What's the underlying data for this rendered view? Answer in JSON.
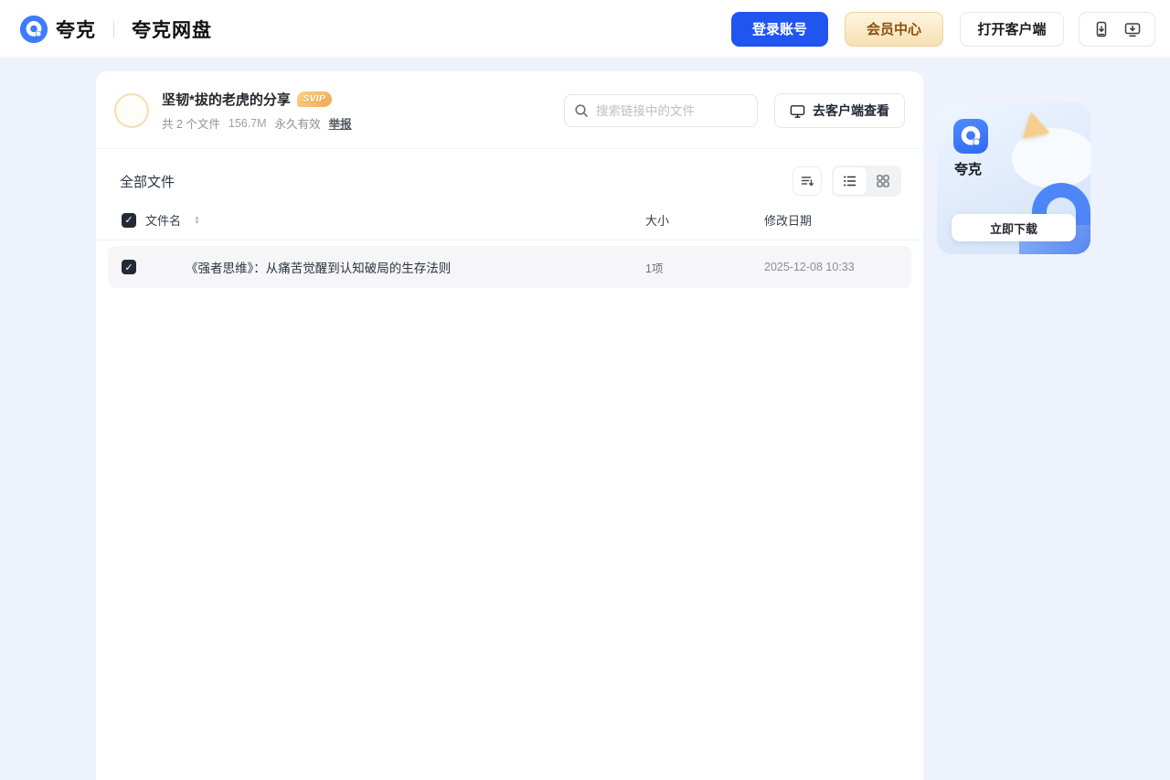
{
  "header": {
    "logo_text": "夸克",
    "logo_product": "夸克网盘",
    "login_button": "登录账号",
    "vip_button": "会员中心",
    "open_client_button": "打开客户端",
    "icons": [
      "mobile-download-icon",
      "desktop-download-icon"
    ]
  },
  "share": {
    "title": "坚韧*拔的老虎的分享",
    "badge": "SVIP",
    "meta_files": "共 2 个文件",
    "meta_size": "156.7M",
    "meta_valid": "永久有效",
    "report_link": "举报",
    "search_placeholder": "搜索链接中的文件",
    "client_view_button": "去客户端查看"
  },
  "files": {
    "section_title": "全部文件",
    "columns": {
      "name": "文件名",
      "size": "大小",
      "date": "修改日期"
    },
    "header_checkbox_checked": true,
    "rows": [
      {
        "name": "《强者思维》：从痛苦觉醒到认知破局的生存法则",
        "size": "1项",
        "date": "2025-12-08 10:33",
        "checked": true
      }
    ],
    "view_mode": "list"
  },
  "promo": {
    "app_name": "夸克",
    "download_button": "立即下载"
  },
  "check_glyph": "✓",
  "sort_up_glyph": "▲",
  "sort_down_glyph": "▼",
  "colors": {
    "accent_blue": "#2155F0",
    "logo_blue": "#3D7BFF",
    "vip_gold_light": "#fdf6e1",
    "vip_gold_dark": "#f7dfb2",
    "vip_text": "#8a520e",
    "badge_gold": "#f2a74e",
    "page_bg": "#eef2fc",
    "row_bg": "#f6f6f8",
    "checkbox_bg": "#232a35"
  }
}
